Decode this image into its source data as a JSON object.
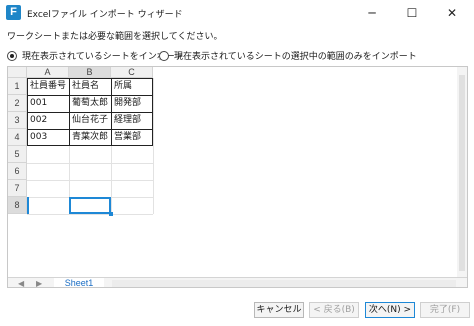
{
  "window": {
    "title": "Excelファイル インポート ウィザード",
    "icon_letter": "F",
    "minimize": "─",
    "maximize": "☐",
    "close": "✕"
  },
  "instruction": "ワークシートまたは必要な範囲を選択してください。",
  "options": [
    {
      "label": "現在表示されているシートをインポート",
      "selected": true
    },
    {
      "label": "現在表示されているシートの選択中の範囲のみをインポート",
      "selected": false
    }
  ],
  "sheet": {
    "columns": [
      "A",
      "B",
      "C"
    ],
    "rows": [
      "1",
      "2",
      "3",
      "4",
      "5",
      "6",
      "7",
      "8"
    ],
    "cells": [
      [
        "社員番号",
        "社員名",
        "所属"
      ],
      [
        "001",
        "葡萄太郎",
        "開発部"
      ],
      [
        "002",
        "仙台花子",
        "経理部"
      ],
      [
        "003",
        "青葉次郎",
        "営業部"
      ]
    ],
    "selected_cell": "B8"
  },
  "tabs": {
    "nav_left": "◀",
    "nav_right": "▶",
    "sheet_name": "Sheet1"
  },
  "buttons": {
    "cancel": "キャンセル",
    "back": "< 戻る(B)",
    "next": "次へ(N) >",
    "finish": "完了(F)"
  }
}
